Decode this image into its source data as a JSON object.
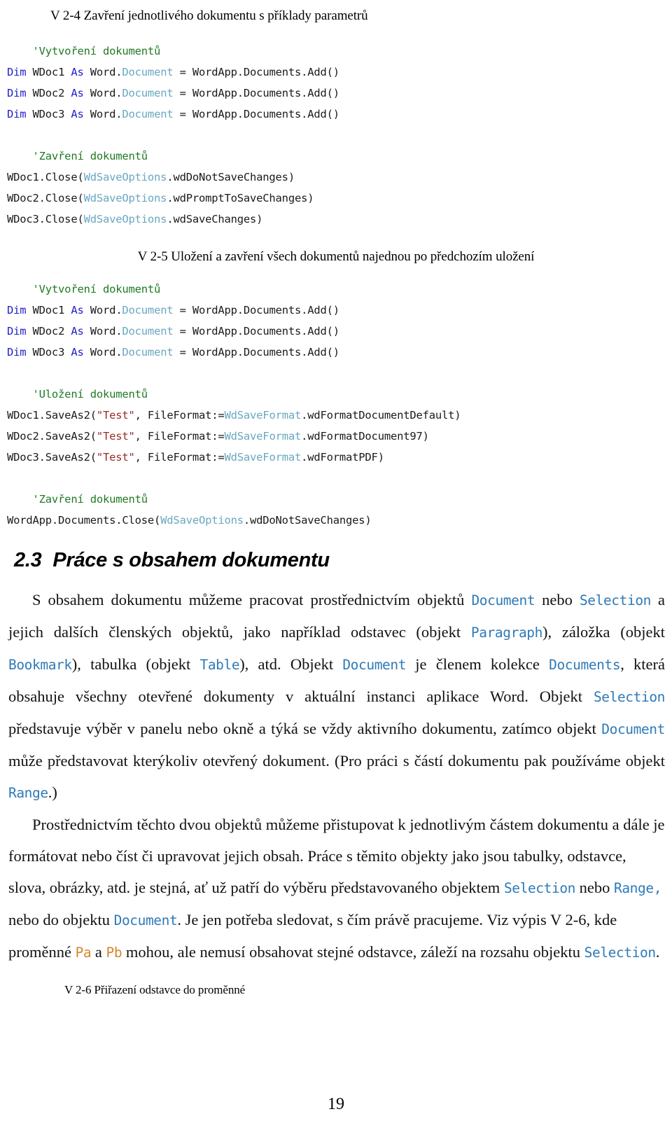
{
  "page": {
    "number": "19",
    "language": "cs"
  },
  "listing_v24": {
    "caption": "V 2-4 Zavření jednotlivého dokumentu s příklady parametrů",
    "lines": [
      {
        "segments": [
          {
            "t": "    'Vytvoření dokumentů",
            "c": "cmt"
          }
        ]
      },
      {
        "segments": [
          {
            "t": "Dim",
            "c": "kw"
          },
          {
            "t": " WDoc1 ",
            "c": ""
          },
          {
            "t": "As",
            "c": "kw"
          },
          {
            "t": " Word.",
            "c": ""
          },
          {
            "t": "Document",
            "c": "type"
          },
          {
            "t": " = WordApp.Documents.Add()",
            "c": ""
          }
        ]
      },
      {
        "segments": [
          {
            "t": "Dim",
            "c": "kw"
          },
          {
            "t": " WDoc2 ",
            "c": ""
          },
          {
            "t": "As",
            "c": "kw"
          },
          {
            "t": " Word.",
            "c": ""
          },
          {
            "t": "Document",
            "c": "type"
          },
          {
            "t": " = WordApp.Documents.Add()",
            "c": ""
          }
        ]
      },
      {
        "segments": [
          {
            "t": "Dim",
            "c": "kw"
          },
          {
            "t": " WDoc3 ",
            "c": ""
          },
          {
            "t": "As",
            "c": "kw"
          },
          {
            "t": " Word.",
            "c": ""
          },
          {
            "t": "Document",
            "c": "type"
          },
          {
            "t": " = WordApp.Documents.Add()",
            "c": ""
          }
        ]
      },
      {
        "segments": [
          {
            "t": " ",
            "c": ""
          }
        ]
      },
      {
        "segments": [
          {
            "t": "    'Zavření dokumentů",
            "c": "cmt"
          }
        ]
      },
      {
        "segments": [
          {
            "t": "WDoc1.Close(",
            "c": ""
          },
          {
            "t": "WdSaveOptions",
            "c": "type"
          },
          {
            "t": ".wdDoNotSaveChanges)",
            "c": ""
          }
        ]
      },
      {
        "segments": [
          {
            "t": "WDoc2.Close(",
            "c": ""
          },
          {
            "t": "WdSaveOptions",
            "c": "type"
          },
          {
            "t": ".wdPromptToSaveChanges)",
            "c": ""
          }
        ]
      },
      {
        "segments": [
          {
            "t": "WDoc3.Close(",
            "c": ""
          },
          {
            "t": "WdSaveOptions",
            "c": "type"
          },
          {
            "t": ".wdSaveChanges)",
            "c": ""
          }
        ]
      }
    ]
  },
  "listing_v25": {
    "caption": "V 2-5 Uložení a zavření všech dokumentů najednou po předchozím uložení",
    "lines": [
      {
        "segments": [
          {
            "t": "    'Vytvoření dokumentů",
            "c": "cmt"
          }
        ]
      },
      {
        "segments": [
          {
            "t": "Dim",
            "c": "kw"
          },
          {
            "t": " WDoc1 ",
            "c": ""
          },
          {
            "t": "As",
            "c": "kw"
          },
          {
            "t": " Word.",
            "c": ""
          },
          {
            "t": "Document",
            "c": "type"
          },
          {
            "t": " = WordApp.Documents.Add()",
            "c": ""
          }
        ]
      },
      {
        "segments": [
          {
            "t": "Dim",
            "c": "kw"
          },
          {
            "t": " WDoc2 ",
            "c": ""
          },
          {
            "t": "As",
            "c": "kw"
          },
          {
            "t": " Word.",
            "c": ""
          },
          {
            "t": "Document",
            "c": "type"
          },
          {
            "t": " = WordApp.Documents.Add()",
            "c": ""
          }
        ]
      },
      {
        "segments": [
          {
            "t": "Dim",
            "c": "kw"
          },
          {
            "t": " WDoc3 ",
            "c": ""
          },
          {
            "t": "As",
            "c": "kw"
          },
          {
            "t": " Word.",
            "c": ""
          },
          {
            "t": "Document",
            "c": "type"
          },
          {
            "t": " = WordApp.Documents.Add()",
            "c": ""
          }
        ]
      },
      {
        "segments": [
          {
            "t": " ",
            "c": ""
          }
        ]
      },
      {
        "segments": [
          {
            "t": "    'Uložení dokumentů",
            "c": "cmt"
          }
        ]
      },
      {
        "segments": [
          {
            "t": "WDoc1.SaveAs2(",
            "c": ""
          },
          {
            "t": "\"Test\"",
            "c": "str"
          },
          {
            "t": ", FileFormat:=",
            "c": ""
          },
          {
            "t": "WdSaveFormat",
            "c": "type"
          },
          {
            "t": ".wdFormatDocumentDefault)",
            "c": ""
          }
        ]
      },
      {
        "segments": [
          {
            "t": "WDoc2.SaveAs2(",
            "c": ""
          },
          {
            "t": "\"Test\"",
            "c": "str"
          },
          {
            "t": ", FileFormat:=",
            "c": ""
          },
          {
            "t": "WdSaveFormat",
            "c": "type"
          },
          {
            "t": ".wdFormatDocument97)",
            "c": ""
          }
        ]
      },
      {
        "segments": [
          {
            "t": "WDoc3.SaveAs2(",
            "c": ""
          },
          {
            "t": "\"Test\"",
            "c": "str"
          },
          {
            "t": ", FileFormat:=",
            "c": ""
          },
          {
            "t": "WdSaveFormat",
            "c": "type"
          },
          {
            "t": ".wdFormatPDF)",
            "c": ""
          }
        ]
      },
      {
        "segments": [
          {
            "t": " ",
            "c": ""
          }
        ]
      },
      {
        "segments": [
          {
            "t": "    'Zavření dokumentů",
            "c": "cmt"
          }
        ]
      },
      {
        "segments": [
          {
            "t": "WordApp.Documents.Close(",
            "c": ""
          },
          {
            "t": "WdSaveOptions",
            "c": "type"
          },
          {
            "t": ".wdDoNotSaveChanges)",
            "c": ""
          }
        ]
      }
    ]
  },
  "section": {
    "number": "2.3",
    "title": "Práce s obsahem dokumentu"
  },
  "paragraph1": [
    {
      "t": "S obsahem dokumentu můžeme pracovat prostřednictvím objektů ",
      "c": ""
    },
    {
      "t": "Document",
      "c": "inl"
    },
    {
      "t": " nebo ",
      "c": ""
    },
    {
      "t": "Selection",
      "c": "inl"
    },
    {
      "t": " a jejich dalších členských objektů, jako například odstavec (objekt ",
      "c": ""
    },
    {
      "t": "Paragraph",
      "c": "inl"
    },
    {
      "t": "), záložka (objekt ",
      "c": ""
    },
    {
      "t": "Bookmark",
      "c": "inl"
    },
    {
      "t": "), tabulka (objekt ",
      "c": ""
    },
    {
      "t": "Table",
      "c": "inl"
    },
    {
      "t": "), atd. Objekt ",
      "c": ""
    },
    {
      "t": "Document",
      "c": "inl"
    },
    {
      "t": " je členem kolekce ",
      "c": ""
    },
    {
      "t": "Documents",
      "c": "inl"
    },
    {
      "t": ", která obsahuje všechny otevřené dokumenty v aktuální instanci aplikace Word. Objekt ",
      "c": ""
    },
    {
      "t": "Selection",
      "c": "inl"
    },
    {
      "t": " představuje výběr v panelu nebo okně a týká se vždy aktivního dokumentu, zatímco objekt ",
      "c": ""
    },
    {
      "t": "Document",
      "c": "inl"
    },
    {
      "t": " může představovat kterýkoliv otevřený dokument. (Pro práci s částí dokumentu pak používáme objekt ",
      "c": ""
    },
    {
      "t": "Range",
      "c": "inl"
    },
    {
      "t": ".)",
      "c": ""
    }
  ],
  "paragraph2": [
    {
      "t": "Prostřednictvím těchto dvou objektů můžeme přistupovat k jednotlivým částem dokumentu a dále je formátovat nebo číst či upravovat jejich obsah. Práce s těmito objekty jako jsou tabulky, odstavce, slova, obrázky, atd. je stejná, ať už patří do výběru představovaného objektem ",
      "c": ""
    },
    {
      "t": "Selection",
      "c": "inl"
    },
    {
      "t": " nebo ",
      "c": ""
    },
    {
      "t": "Range,",
      "c": "inl"
    },
    {
      "t": " nebo do objektu ",
      "c": ""
    },
    {
      "t": "Document",
      "c": "inl"
    },
    {
      "t": ". Je jen potřeba sledovat, s čím právě pracujeme. Viz výpis V 2-6, kde proměnné ",
      "c": ""
    },
    {
      "t": "Pa",
      "c": "inl amber"
    },
    {
      "t": " a ",
      "c": ""
    },
    {
      "t": "Pb",
      "c": "inl amber"
    },
    {
      "t": " mohou, ale nemusí obsahovat stejné odstavce, záleží na rozsahu objektu ",
      "c": ""
    },
    {
      "t": "Selection",
      "c": "inl"
    },
    {
      "t": ".",
      "c": ""
    }
  ],
  "listing_v26": {
    "caption": "V 2-6 Přiřazení odstavce do proměnné"
  },
  "colors": {
    "comment_green": "#1f7a23",
    "keyword_blue": "#2020c8",
    "type_teal": "#69a7c0",
    "string_red": "#9c2a28",
    "inline_code_blue": "#2e7ab8",
    "inline_code_amber": "#d2872b",
    "body_text": "#111111",
    "background": "#ffffff"
  }
}
